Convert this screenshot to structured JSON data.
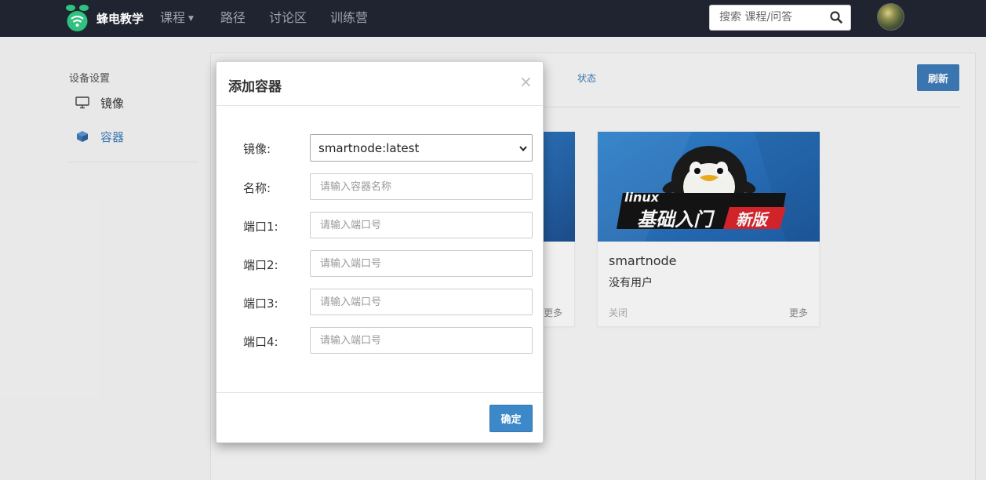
{
  "navbar": {
    "brand": "蜂电教学",
    "links": [
      {
        "label": "课程",
        "dropdown": true
      },
      {
        "label": "路径"
      },
      {
        "label": "讨论区"
      },
      {
        "label": "训练营"
      }
    ],
    "search_placeholder": "搜索 课程/问答",
    "search_icon": "search-icon"
  },
  "sidebar": {
    "heading": "设备设置",
    "items": [
      {
        "label": "镜像",
        "icon": "monitor-icon",
        "active": false
      },
      {
        "label": "容器",
        "icon": "cube-icon",
        "active": true
      }
    ]
  },
  "main": {
    "tab_status": "状态",
    "refresh_label": "刷新",
    "cards": [
      {
        "more_label": "更多"
      },
      {
        "image_title_latin": "linux",
        "image_title_cn": "基础入门",
        "image_badge": "新版",
        "name": "smartnode",
        "users": "没有用户",
        "close_label": "关闭",
        "more_label": "更多"
      }
    ]
  },
  "modal": {
    "title": "添加容器",
    "close_symbol": "×",
    "fields": {
      "image": {
        "label": "镜像:",
        "value": "smartnode:latest"
      },
      "name": {
        "label": "名称:",
        "placeholder": "请输入容器名称"
      },
      "port1": {
        "label": "端口1:",
        "placeholder": "请输入端口号"
      },
      "port2": {
        "label": "端口2:",
        "placeholder": "请输入端口号"
      },
      "port3": {
        "label": "端口3:",
        "placeholder": "请输入端口号"
      },
      "port4": {
        "label": "端口4:",
        "placeholder": "请输入端口号"
      }
    },
    "confirm_label": "确定"
  },
  "colors": {
    "navbar_bg": "#1f2430",
    "accent": "#3d7ab8",
    "brand_green": "#2ec27e"
  }
}
